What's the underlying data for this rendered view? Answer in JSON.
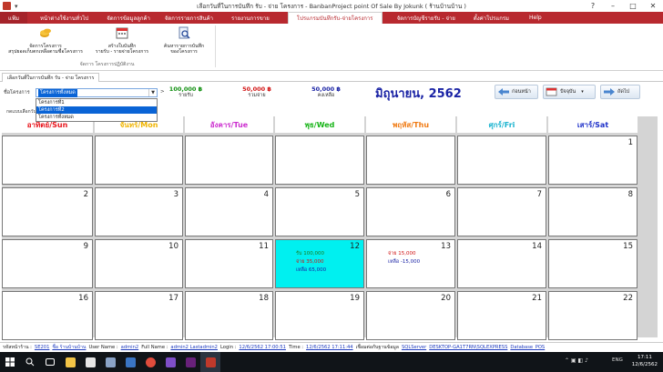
{
  "window": {
    "title": "เลือกวันที่ในการบันทึก รับ - จ่าย โครงการ - BanbanProject point Of Sale By Jokunk  ( ร้านบ้านบ้าน )",
    "quick_access": "▾"
  },
  "ribbon_tabs": [
    {
      "label": "แฟ้ม"
    },
    {
      "label": "หน้าต่างใช้งานทั่วไป"
    },
    {
      "label": "จัดการข้อมูลลูกค้า"
    },
    {
      "label": "จัดการรายการสินค้า"
    },
    {
      "label": "รายงานการขาย"
    },
    {
      "label": "โปรแกรมบันทึกรับ-จ่ายโครงการ"
    },
    {
      "label": "จัดการบัญชีรายรับ - จ่าย"
    },
    {
      "label": "ตั้งค่าโปรแกรม"
    },
    {
      "label": "Help"
    }
  ],
  "ribbon": {
    "buttons": [
      {
        "label1": "จัดการโครงการ",
        "label2": "สรุปยอดเก็บตกเหลือตามชื่อโครงการ"
      },
      {
        "label1": "สร้างใบบันทึก",
        "label2": "รายรับ - รายจ่ายโครงการ"
      },
      {
        "label1": "ค้นหารายการบันทึก",
        "label2": "ของโครงการ"
      }
    ],
    "group_label": "จัดการ โครงการปฏิบัติงาน"
  },
  "doc_tab": "เลือกวันที่ในการบันทึก รับ - จ่าย โครงการ",
  "controls": {
    "project_label": "ชื่อโครงการ",
    "selected": "โครงการทั้งหมด",
    "options": [
      "โครงการที่1",
      "โครงการที่2",
      "โครงการทั้งหมด"
    ],
    "income_value": "100,000 ฿",
    "income_caption": "รายรับ",
    "expense_value": "50,000 ฿",
    "expense_caption": "รวมจ่าย",
    "balance_value": "50,000 ฿",
    "balance_caption": "คงเหลือ",
    "month_title": "มิถุนายน, 2562",
    "prev_label": "ก่อนหน้า",
    "today_label": "ปัจจุบัน",
    "next_label": "ถัดไป",
    "grid_caption": "กดแบบเลือกวันที่"
  },
  "calendar": {
    "headers": [
      {
        "label": "อาทิตย์/Sun",
        "color": "#e8141b"
      },
      {
        "label": "จันทร์/Mon",
        "color": "#f0b400"
      },
      {
        "label": "อังคาร/Tue",
        "color": "#cc2ecf"
      },
      {
        "label": "พุธ/Wed",
        "color": "#17b417"
      },
      {
        "label": "พฤหัส/Thu",
        "color": "#f07a12"
      },
      {
        "label": "ศุกร์/Fri",
        "color": "#19b3cf"
      },
      {
        "label": "เสาร์/Sat",
        "color": "#1b2ec8"
      }
    ],
    "weeks": [
      [
        "",
        "",
        "",
        "",
        "",
        "",
        "1"
      ],
      [
        "2",
        "3",
        "4",
        "5",
        "6",
        "7",
        "8"
      ],
      [
        "9",
        "10",
        "11",
        "12",
        "13",
        "14",
        "15"
      ],
      [
        "16",
        "17",
        "18",
        "19",
        "20",
        "21",
        "22"
      ]
    ],
    "highlight_color": "#00f0f0",
    "entries": {
      "12": {
        "lines": [
          {
            "text": "รับ  100,000",
            "color": "#1a7a1a"
          },
          {
            "text": "จ่าย  35,000",
            "color": "#d11212"
          },
          {
            "text": "เหลือ  65,000",
            "color": "#1a23a5"
          }
        ]
      },
      "13": {
        "lines": [
          {
            "text": "จ่าย  15,000",
            "color": "#d11212"
          },
          {
            "text": "เหลือ  -15,000",
            "color": "#1a23a5"
          }
        ]
      }
    }
  },
  "status": {
    "page_label": "รหัสหน้าร้าน :",
    "page_code": "SE201",
    "shop_label": "ชื่อ ร้านบ้านบ้าน",
    "user_label": "User Name :",
    "user_value": "admin2",
    "full_label": "Full Name :",
    "full_value": "admin2 Lastadmin2",
    "login_label": "Login :",
    "login_value": "12/6/2562 17:00:51",
    "time_label": "Time :",
    "time_value": "12/6/2562 17:11:44",
    "db_label": "เชื่อมต่อกับฐานข้อมูล",
    "sql_label": "SQLServer",
    "server_value": "DESKTOP-GA1T7RN\\SQLEXPRESS",
    "db_value": "Database_POS"
  },
  "taskbar": {
    "lang": "ENG",
    "time": "17:11",
    "date": "12/6/2562"
  }
}
